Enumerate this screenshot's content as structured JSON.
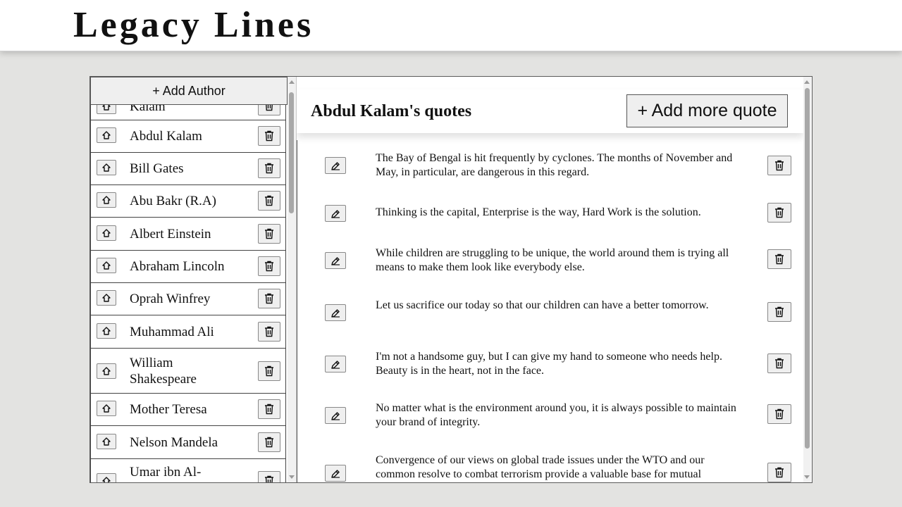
{
  "app": {
    "title": "Legacy Lines"
  },
  "authors_panel": {
    "add_author_label": "+ Add Author",
    "items": [
      {
        "name": "Kalam"
      },
      {
        "name": "Abdul Kalam"
      },
      {
        "name": "Bill Gates"
      },
      {
        "name": "Abu Bakr (R.A)"
      },
      {
        "name": "Albert Einstein"
      },
      {
        "name": "Abraham Lincoln"
      },
      {
        "name": "Oprah Winfrey"
      },
      {
        "name": "Muhammad Ali"
      },
      {
        "name": "William Shakespeare"
      },
      {
        "name": "Mother Teresa"
      },
      {
        "name": "Nelson Mandela"
      },
      {
        "name": "Umar ibn Al-Khattab"
      }
    ],
    "item_icon": "home-arrow-icon",
    "delete_icon": "trash-icon"
  },
  "quotes_panel": {
    "title": "Abdul Kalam's quotes",
    "add_quote_label": "+ Add more quote",
    "edit_icon": "pencil-edit-icon",
    "delete_icon": "trash-icon",
    "quotes": [
      {
        "text": "The Bay of Bengal is hit frequently by cyclones. The months of November and May, in particular, are dangerous in this regard."
      },
      {
        "text": "Thinking is the capital, Enterprise is the way, Hard Work is the solution."
      },
      {
        "text": "While children are struggling to be unique, the world around them is trying all means to make them look like everybody else."
      },
      {
        "text": "Let us sacrifice our today so that our children can have a better tomorrow."
      },
      {
        "text": "I'm not a handsome guy, but I can give my hand to someone who needs help. Beauty is in the heart, not in the face."
      },
      {
        "text": "No matter what is the environment around you, it is always possible to maintain your brand of integrity."
      },
      {
        "text": "Convergence of our views on global trade issues under the WTO and our common resolve to combat terrorism provide a valuable base for mutual"
      }
    ]
  }
}
